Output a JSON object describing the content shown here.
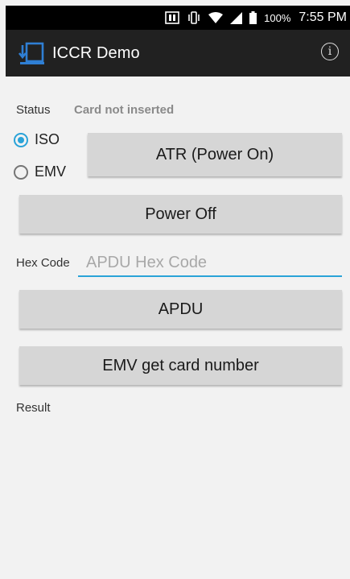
{
  "status_bar": {
    "battery_percent": "100%",
    "time": "7:55 PM",
    "icons": [
      "nfc-icon",
      "vibrate-icon",
      "wifi-icon",
      "signal-icon",
      "battery-icon"
    ]
  },
  "app_bar": {
    "title": "ICCR Demo",
    "info_icon": "info-icon"
  },
  "form": {
    "status_label": "Status",
    "status_value": "Card not inserted",
    "mode_options": [
      {
        "label": "ISO",
        "checked": true
      },
      {
        "label": "EMV",
        "checked": false
      }
    ],
    "atr_button": "ATR (Power On)",
    "power_off_button": "Power Off",
    "hex_label": "Hex Code",
    "hex_value": "",
    "hex_placeholder": "APDU Hex Code",
    "apdu_button": "APDU",
    "emv_button": "EMV get card number",
    "result_label": "Result",
    "result_value": ""
  },
  "colors": {
    "accent": "#2aa3d8",
    "app_bar": "#212121",
    "status_bar": "#000000",
    "button": "#d6d6d6",
    "background": "#f2f2f2"
  }
}
